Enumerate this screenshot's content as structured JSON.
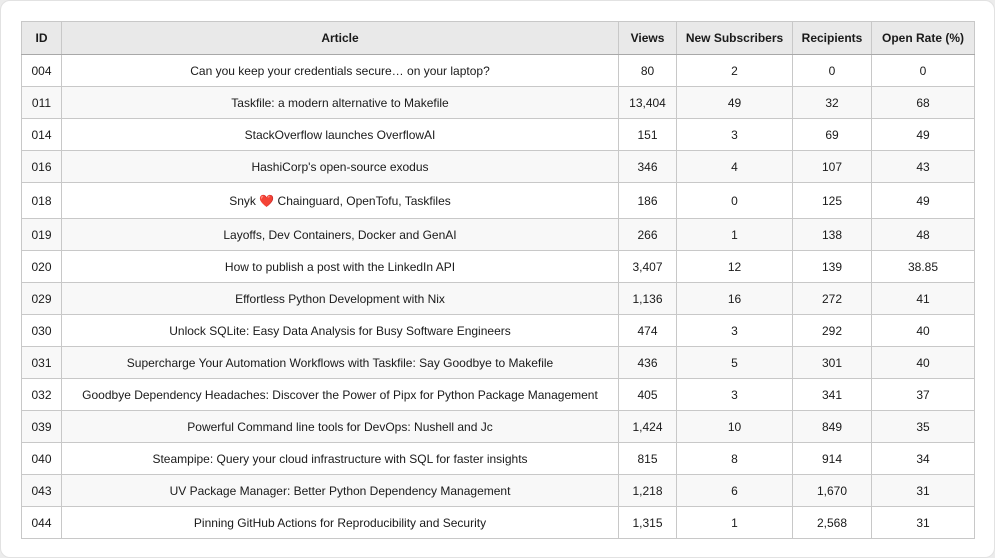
{
  "columns": [
    "ID",
    "Article",
    "Views",
    "New Subscribers",
    "Recipients",
    "Open Rate (%)"
  ],
  "rows": [
    {
      "id": "004",
      "article": "Can you keep your credentials secure… on your laptop?",
      "views": "80",
      "subs": "2",
      "recipients": "0",
      "open": "0"
    },
    {
      "id": "011",
      "article": "Taskfile: a modern alternative to Makefile",
      "views": "13,404",
      "subs": "49",
      "recipients": "32",
      "open": "68"
    },
    {
      "id": "014",
      "article": "StackOverflow launches OverflowAI",
      "views": "151",
      "subs": "3",
      "recipients": "69",
      "open": "49"
    },
    {
      "id": "016",
      "article": "HashiCorp's open-source exodus",
      "views": "346",
      "subs": "4",
      "recipients": "107",
      "open": "43"
    },
    {
      "id": "018",
      "article": "Snyk ❤️ Chainguard, OpenTofu, Taskfiles",
      "views": "186",
      "subs": "0",
      "recipients": "125",
      "open": "49"
    },
    {
      "id": "019",
      "article": "Layoffs, Dev Containers, Docker and GenAI",
      "views": "266",
      "subs": "1",
      "recipients": "138",
      "open": "48"
    },
    {
      "id": "020",
      "article": "How to publish a post with the LinkedIn API",
      "views": "3,407",
      "subs": "12",
      "recipients": "139",
      "open": "38.85"
    },
    {
      "id": "029",
      "article": "Effortless Python Development with Nix",
      "views": "1,136",
      "subs": "16",
      "recipients": "272",
      "open": "41"
    },
    {
      "id": "030",
      "article": "Unlock SQLite: Easy Data Analysis for Busy Software Engineers",
      "views": "474",
      "subs": "3",
      "recipients": "292",
      "open": "40"
    },
    {
      "id": "031",
      "article": "Supercharge Your Automation Workflows with Taskfile: Say Goodbye to Makefile",
      "views": "436",
      "subs": "5",
      "recipients": "301",
      "open": "40"
    },
    {
      "id": "032",
      "article": "Goodbye Dependency Headaches: Discover the Power of Pipx for Python Package Management",
      "views": "405",
      "subs": "3",
      "recipients": "341",
      "open": "37"
    },
    {
      "id": "039",
      "article": "Powerful Command line tools for DevOps: Nushell and Jc",
      "views": "1,424",
      "subs": "10",
      "recipients": "849",
      "open": "35"
    },
    {
      "id": "040",
      "article": "Steampipe: Query your cloud infrastructure with SQL for faster insights",
      "views": "815",
      "subs": "8",
      "recipients": "914",
      "open": "34"
    },
    {
      "id": "043",
      "article": "UV Package Manager: Better Python Dependency Management",
      "views": "1,218",
      "subs": "6",
      "recipients": "1,670",
      "open": "31"
    },
    {
      "id": "044",
      "article": "Pinning GitHub Actions for Reproducibility and Security",
      "views": "1,315",
      "subs": "1",
      "recipients": "2,568",
      "open": "31"
    }
  ]
}
